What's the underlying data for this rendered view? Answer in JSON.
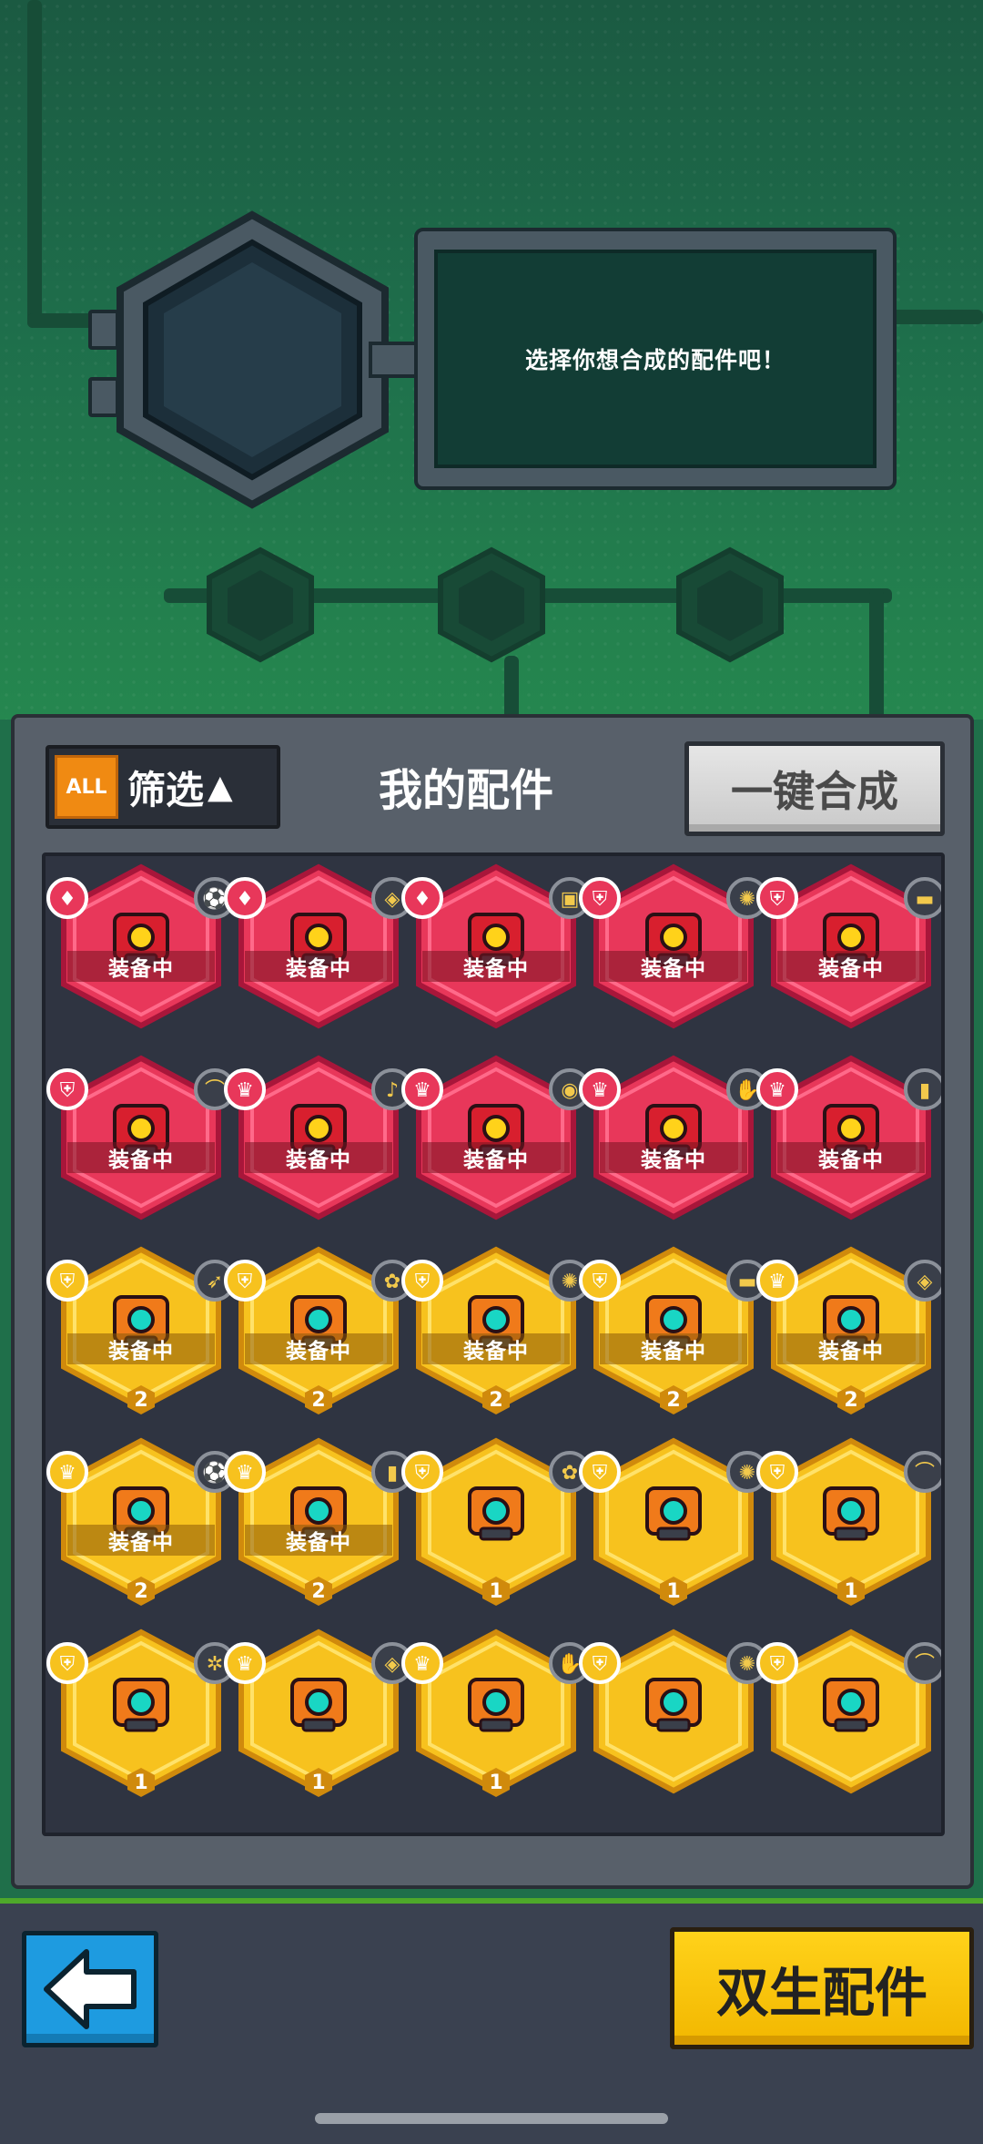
{
  "top": {
    "hint": "选择你想合成的配件吧！"
  },
  "panel": {
    "filter_badge": "ALL",
    "filter_label": "筛选",
    "filter_arrow": "▲",
    "title": "我的配件",
    "merge_all_label": "一键合成"
  },
  "colors": {
    "rare_red": "#e8375a",
    "epic_gold": "#f7c21e",
    "panel_bg": "#2f3441",
    "twin_button": "#ffd21a",
    "back_button": "#1e9be0"
  },
  "parts": [
    {
      "rarity": "red",
      "left_badge": "crest-icon",
      "right_badge": "ball-icon",
      "equipped": "装备中",
      "level": "",
      "part": "robot-head-part"
    },
    {
      "rarity": "red",
      "left_badge": "crest-icon",
      "right_badge": "drill-icon",
      "equipped": "装备中",
      "level": "",
      "part": "core-ring-part"
    },
    {
      "rarity": "red",
      "left_badge": "crest-icon",
      "right_badge": "engine-icon",
      "equipped": "装备中",
      "level": "",
      "part": "cannon-box-part"
    },
    {
      "rarity": "red",
      "left_badge": "shield-icon",
      "right_badge": "saw-icon",
      "equipped": "装备中",
      "level": "",
      "part": "hex-armor-part"
    },
    {
      "rarity": "red",
      "left_badge": "shield-icon",
      "right_badge": "brick-icon",
      "equipped": "装备中",
      "level": "",
      "part": "battery-pack-part"
    },
    {
      "rarity": "red",
      "left_badge": "shield-icon",
      "right_badge": "arc-icon",
      "equipped": "装备中",
      "level": "",
      "part": "traffic-light-part"
    },
    {
      "rarity": "red",
      "left_badge": "crown-icon",
      "right_badge": "bell-icon",
      "equipped": "装备中",
      "level": "",
      "part": "twin-tank-part"
    },
    {
      "rarity": "red",
      "left_badge": "crown-icon",
      "right_badge": "camera-icon",
      "equipped": "装备中",
      "level": "",
      "part": "eye-visor-part"
    },
    {
      "rarity": "red",
      "left_badge": "crown-icon",
      "right_badge": "glove-icon",
      "equipped": "装备中",
      "level": "",
      "part": "curtain-part"
    },
    {
      "rarity": "red",
      "left_badge": "crown-icon",
      "right_badge": "bottle-icon",
      "equipped": "装备中",
      "level": "",
      "part": "gem-ring-part"
    },
    {
      "rarity": "gold",
      "left_badge": "shield-icon",
      "right_badge": "rocket-icon",
      "equipped": "装备中",
      "level": "2",
      "part": "wing-part"
    },
    {
      "rarity": "gold",
      "left_badge": "shield-icon",
      "right_badge": "plant-icon",
      "equipped": "装备中",
      "level": "2",
      "part": "hammer-part"
    },
    {
      "rarity": "gold",
      "left_badge": "shield-icon",
      "right_badge": "saw-icon",
      "equipped": "装备中",
      "level": "2",
      "part": "coil-part"
    },
    {
      "rarity": "gold",
      "left_badge": "shield-icon",
      "right_badge": "brick-icon",
      "equipped": "装备中",
      "level": "2",
      "part": "radio-part"
    },
    {
      "rarity": "gold",
      "left_badge": "crown-icon",
      "right_badge": "drill-icon",
      "equipped": "装备中",
      "level": "2",
      "part": "lens-part"
    },
    {
      "rarity": "gold",
      "left_badge": "crown-icon",
      "right_badge": "ball-icon",
      "equipped": "装备中",
      "level": "2",
      "part": "dome-part"
    },
    {
      "rarity": "gold",
      "left_badge": "crown-icon",
      "right_badge": "bottle-icon",
      "equipped": "装备中",
      "level": "2",
      "part": "triangle-part"
    },
    {
      "rarity": "gold",
      "left_badge": "shield-icon",
      "right_badge": "plant-icon",
      "equipped": "",
      "level": "1",
      "part": "capsule-part"
    },
    {
      "rarity": "gold",
      "left_badge": "shield-icon",
      "right_badge": "saw-icon",
      "equipped": "",
      "level": "1",
      "part": "coil-part"
    },
    {
      "rarity": "gold",
      "left_badge": "shield-icon",
      "right_badge": "arc-icon",
      "equipped": "",
      "level": "1",
      "part": "traffic-light-part"
    },
    {
      "rarity": "gold",
      "left_badge": "shield-icon",
      "right_badge": "spore-icon",
      "equipped": "",
      "level": "1",
      "part": "walker-part"
    },
    {
      "rarity": "gold",
      "left_badge": "crown-icon",
      "right_badge": "drill-icon",
      "equipped": "",
      "level": "1",
      "part": "lens-part"
    },
    {
      "rarity": "gold",
      "left_badge": "crown-icon",
      "right_badge": "glove-icon",
      "equipped": "",
      "level": "1",
      "part": "pump-part"
    },
    {
      "rarity": "gold",
      "left_badge": "shield-icon",
      "right_badge": "saw-icon",
      "equipped": "",
      "level": "",
      "part": "coil-part"
    },
    {
      "rarity": "gold",
      "left_badge": "shield-icon",
      "right_badge": "arc-icon",
      "equipped": "",
      "level": "",
      "part": "traffic-light-part"
    }
  ],
  "bottom": {
    "twin_label": "双生配件"
  }
}
